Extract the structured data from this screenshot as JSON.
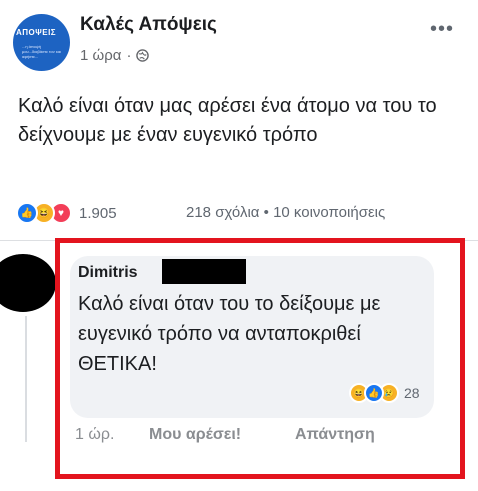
{
  "post": {
    "page_name": "Καλές Απόψεις",
    "avatar_label": "ΑΠΟΨΕΙΣ",
    "avatar_sub": "...η άποψή μου...διαβάστε τον και αφήστε...",
    "time": "1 ώρα",
    "separator": "·",
    "text": "Καλό είναι όταν μας αρέσει ένα άτομο να του το δείχνουμε με έναν ευγενικό τρόπο",
    "reaction_count": "1.905",
    "stats": "218 σχόλια • 10 κοινοποιήσεις",
    "more_icon": "more-dots-icon",
    "privacy_icon": "globe-icon"
  },
  "comment": {
    "author": "Dimitris",
    "text": "Καλό είναι όταν του το δείξουμε με ευγενικό τρόπο να ανταποκριθεί ΘΕΤΙΚΑ!",
    "reaction_count": "28",
    "time": "1 ώρ.",
    "like_label": "Μου αρέσει!",
    "reply_label": "Απάντηση"
  },
  "colors": {
    "highlight_frame": "#e3141e",
    "like_blue": "#1877f2",
    "love_red": "#f33e58",
    "haha_yellow": "#f7b125",
    "bubble_bg": "#f0f2f5"
  }
}
